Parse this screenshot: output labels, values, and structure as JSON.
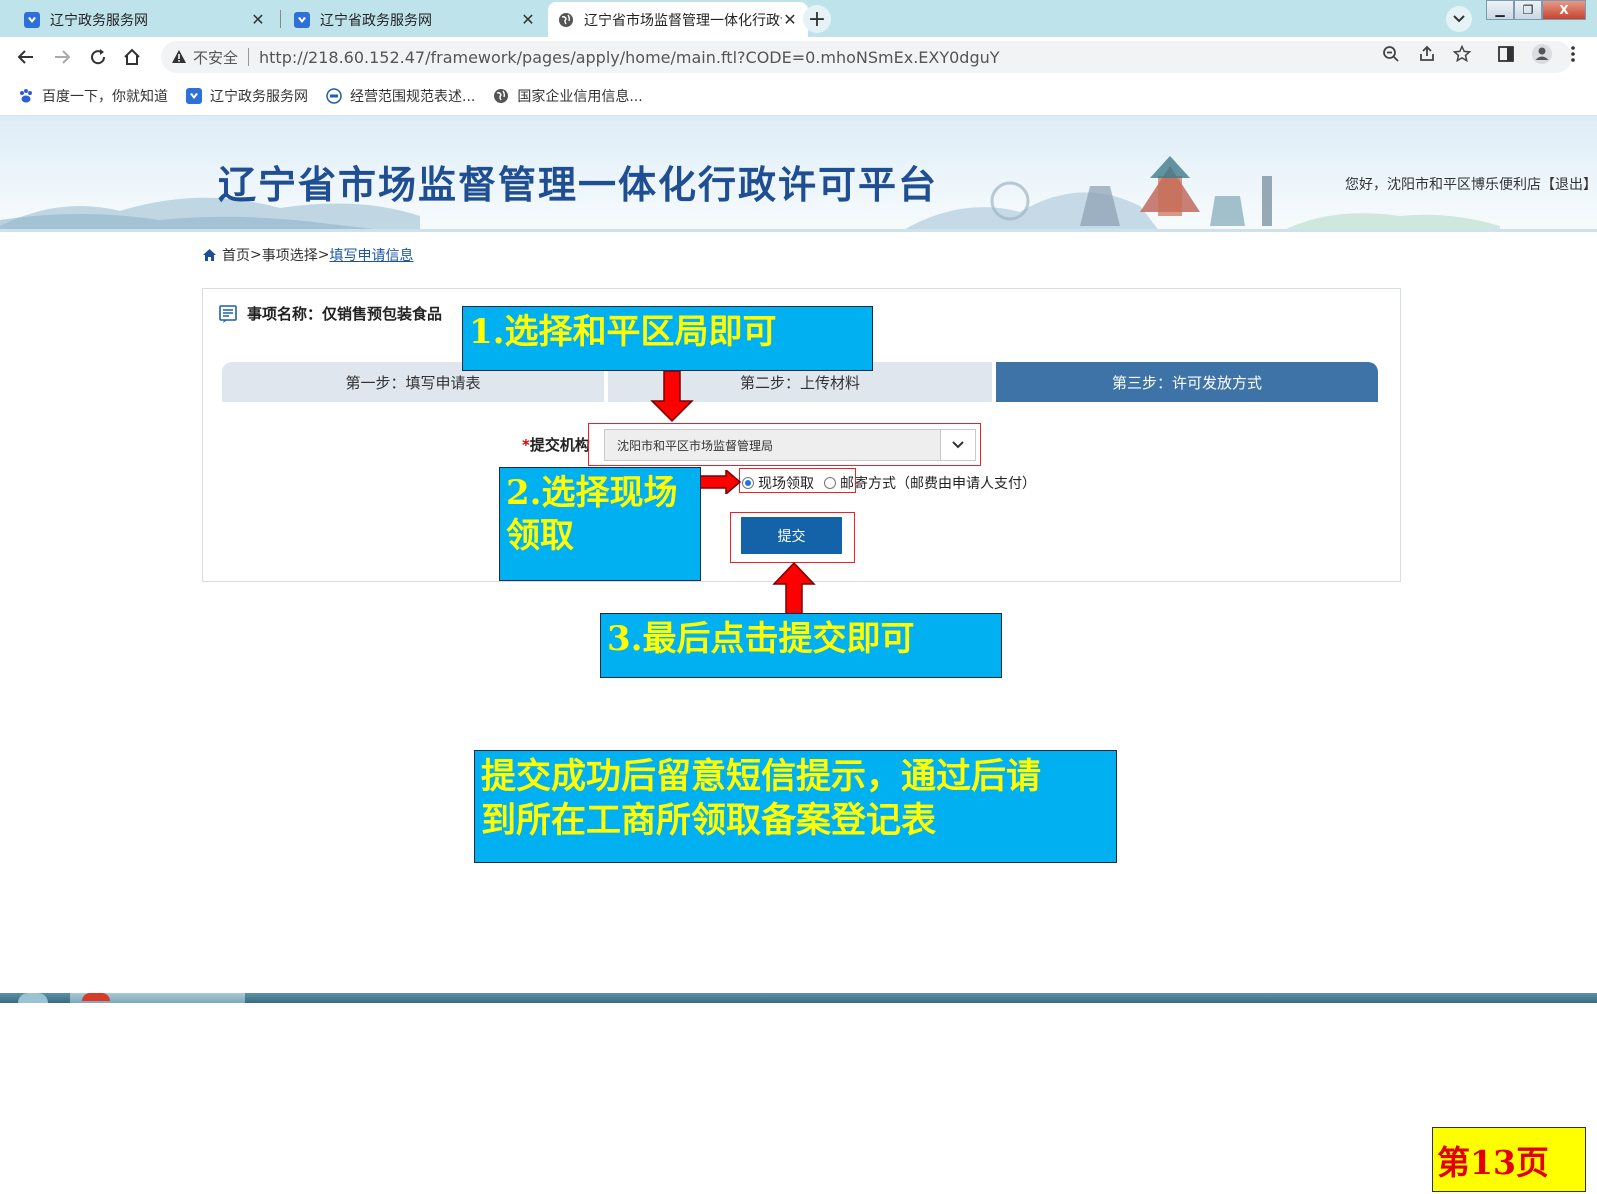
{
  "browser": {
    "tabs": [
      {
        "title": "辽宁政务服务网",
        "active": false
      },
      {
        "title": "辽宁省政务服务网",
        "active": false
      },
      {
        "title": "辽宁省市场监督管理一体化行政许",
        "active": true
      }
    ],
    "new_tab_label": "+",
    "security_label": "不安全",
    "url": "http://218.60.152.47/framework/pages/apply/home/main.ftl?CODE=0.mhoNSmEx.EXY0dguY",
    "bookmarks": [
      "百度一下，你就知道",
      "辽宁政务服务网",
      "经营范围规范表述...",
      "国家企业信用信息..."
    ]
  },
  "header": {
    "site_title": "辽宁省市场监督管理一体化行政许可平台",
    "user_info": "您好，沈阳市和平区博乐便利店【退出】"
  },
  "breadcrumb": {
    "home": "首页",
    "sep1": " > ",
    "mid": "事项选择",
    "sep2": "> ",
    "current": "填写申请信息"
  },
  "form": {
    "item_name_prefix": "事项名称：仅销售预包装食品",
    "steps": [
      "第一步：填写申请表",
      "第二步：上传材料",
      "第三步：许可发放方式"
    ],
    "active_step": 3,
    "org_required_mark": "*",
    "org_label": "提交机构",
    "org_selected": "沈阳市和平区市场监督管理局",
    "radio_options": [
      {
        "label": "现场领取",
        "checked": true
      },
      {
        "label": "邮寄方式（邮费由申请人支付）",
        "checked": false
      }
    ],
    "submit_label": "提交"
  },
  "annotations": {
    "callout1": "1.选择和平区局即可",
    "callout2_line1": "2.选择现场",
    "callout2_line2": "领取",
    "callout3": "3.最后点击提交即可",
    "callout4_line1": "提交成功后留意短信提示，通过后请",
    "callout4_line2": "到所在工商所领取备案登记表"
  },
  "page_label": "第13页",
  "colors": {
    "callout_bg": "#00b0f0",
    "callout_text": "#ffff00",
    "highlight_box": "#e8232a",
    "active_step": "#3e73a8",
    "submit_button": "#1463a8",
    "title_blue": "#1f4e92"
  }
}
